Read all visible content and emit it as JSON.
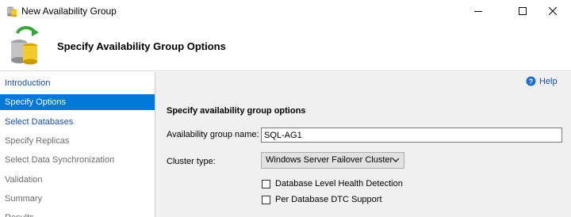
{
  "window": {
    "title": "New Availability Group",
    "app_icon": "availability-group-icon"
  },
  "header": {
    "title": "Specify Availability Group Options",
    "icon": "database-sync-icon"
  },
  "nav": {
    "items": [
      {
        "label": "Introduction",
        "state": "link"
      },
      {
        "label": "Specify Options",
        "state": "selected"
      },
      {
        "label": "Select Databases",
        "state": "link"
      },
      {
        "label": "Specify Replicas",
        "state": "disabled"
      },
      {
        "label": "Select Data Synchronization",
        "state": "disabled"
      },
      {
        "label": "Validation",
        "state": "disabled"
      },
      {
        "label": "Summary",
        "state": "disabled"
      },
      {
        "label": "Results",
        "state": "disabled"
      }
    ]
  },
  "content": {
    "help_label": "Help",
    "section_title": "Specify availability group options",
    "ag_name_label": "Availability group name:",
    "ag_name_value": "SQL-AG1",
    "cluster_type_label": "Cluster type:",
    "cluster_type_value": "Windows Server Failover Cluster",
    "checkbox_health": "Database Level Health Detection",
    "checkbox_dtc": "Per Database DTC Support"
  },
  "colors": {
    "selection": "#0078d7",
    "link": "#1c4ea8"
  }
}
